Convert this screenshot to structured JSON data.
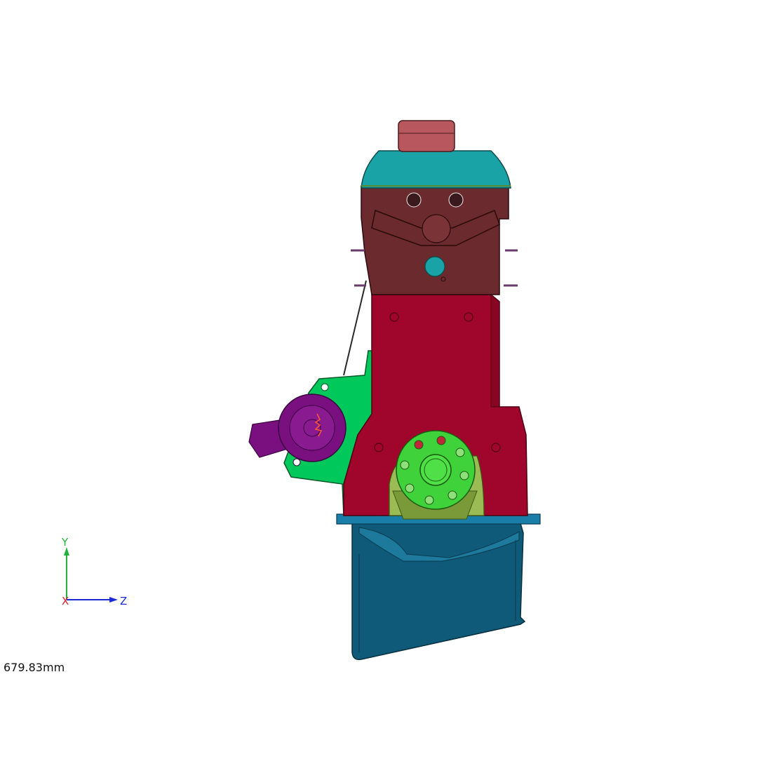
{
  "viewport": {
    "background": "#ffffff",
    "scale_readout": "679.83mm"
  },
  "triad": {
    "x_label": "X",
    "y_label": "Y",
    "z_label": "Z",
    "x_color": "#e0202a",
    "y_color": "#22b33a",
    "z_color": "#1a2bd6"
  },
  "model": {
    "description_colors": {
      "oil_cap": "#b8585e",
      "valve_cover": "#1aa3a6",
      "cylinder_head": "#6b2a2e",
      "block": "#a0052b",
      "bracket": "#00c85a",
      "starter": "#7a1080",
      "crank_flange": "#3fd23a",
      "pulley_housing": "#9bbb55",
      "oil_pan": "#0e5a78",
      "pan_rail": "#1a7fa8"
    }
  }
}
